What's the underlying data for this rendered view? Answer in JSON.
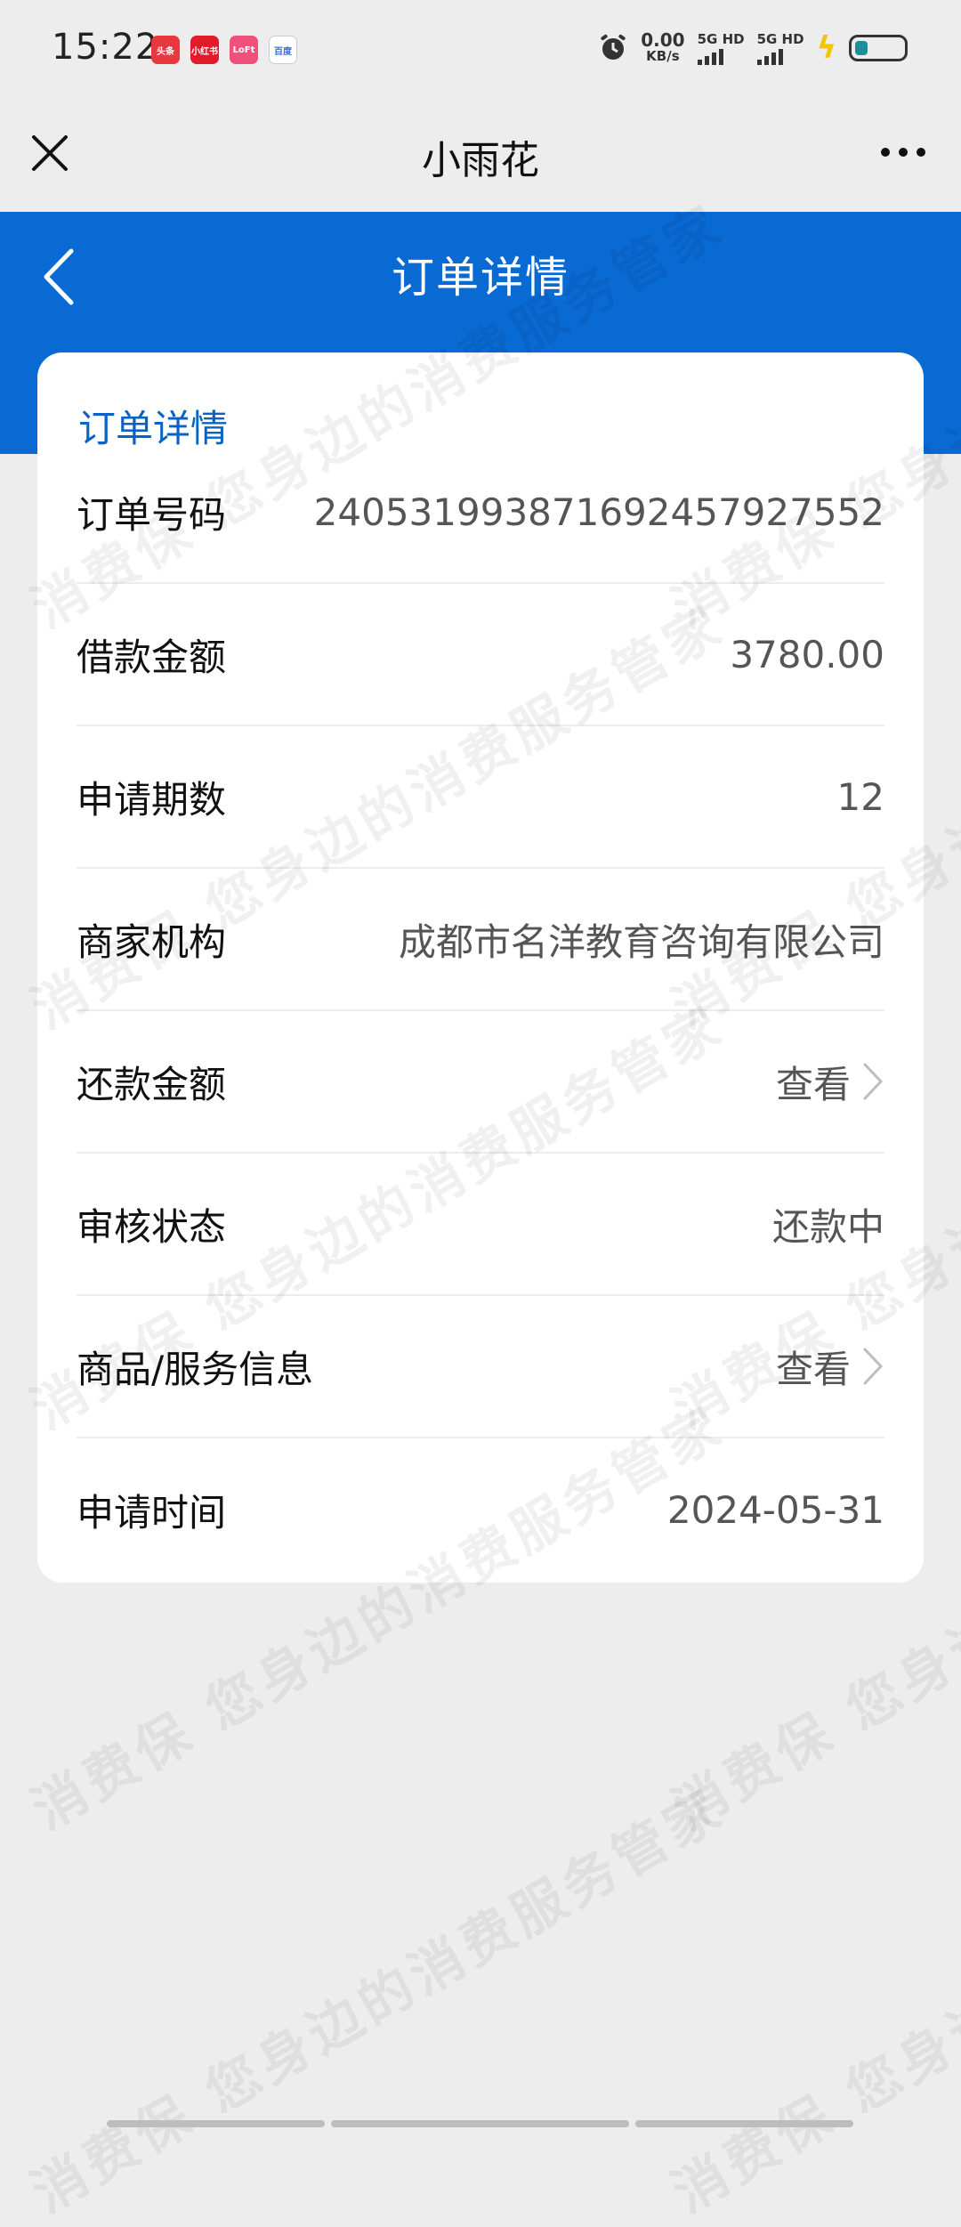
{
  "status_bar": {
    "time": "15:22",
    "apps": [
      "头条",
      "小红书",
      "LoFt",
      "百度"
    ],
    "net_speed": "0.00",
    "net_unit": "KB/s",
    "sim1": "5G HD",
    "sim2": "5G HD"
  },
  "nav": {
    "title": "小雨花"
  },
  "header": {
    "title": "订单详情"
  },
  "card": {
    "title": "订单详情",
    "rows": [
      {
        "label": "订单号码",
        "value": "24053199387169245792755​2"
      },
      {
        "label": "借款金额",
        "value": "3780.00"
      },
      {
        "label": "申请期数",
        "value": "12"
      },
      {
        "label": "商家机构",
        "value": "成都市名洋教育咨询有限公司"
      },
      {
        "label": "还款金额",
        "value": "查看"
      },
      {
        "label": "审核状态",
        "value": "还款中"
      },
      {
        "label": "商品/服务信息",
        "value": "查看"
      },
      {
        "label": "申请时间",
        "value": "2024-05-31"
      }
    ]
  },
  "watermark": {
    "text_a": "消费保 您身边的消费服务管家"
  },
  "colors": {
    "header_blue": "#0a6ad4",
    "title_blue": "#0a62c2",
    "background": "#ededed"
  }
}
